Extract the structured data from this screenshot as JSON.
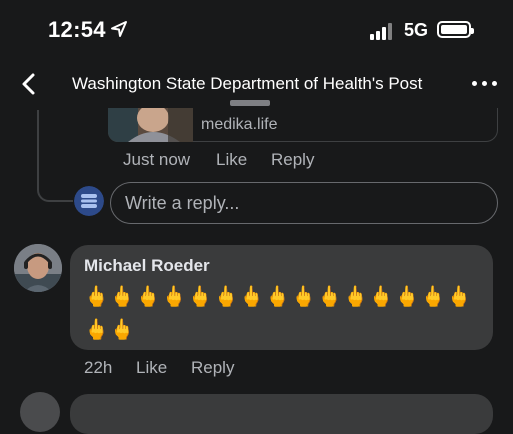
{
  "status_bar": {
    "time": "12:54",
    "network": "5G",
    "icons": [
      "location-arrow-icon",
      "signal-bars-icon",
      "battery-icon"
    ]
  },
  "nav": {
    "title": "Washington State Department of Health's Post",
    "back_icon": "chevron-left-icon",
    "more_icon": "ellipsis-icon"
  },
  "previous_reply": {
    "link_domain": "medika.life",
    "timestamp": "Just now",
    "like_label": "Like",
    "reply_label": "Reply"
  },
  "reply_box": {
    "placeholder": "Write a reply..."
  },
  "comment": {
    "author": "Michael Roeder",
    "emoji_line_1": "🖕🖕🖕🖕🖕🖕🖕🖕🖕🖕🖕🖕🖕🖕🖕",
    "emoji_line_2": "🖕🖕",
    "timestamp": "22h",
    "like_label": "Like",
    "reply_label": "Reply"
  },
  "colors": {
    "background": "#18191a",
    "bubble": "#3a3b3c",
    "text": "#e4e6eb",
    "secondary_text": "#b0b3b8"
  }
}
